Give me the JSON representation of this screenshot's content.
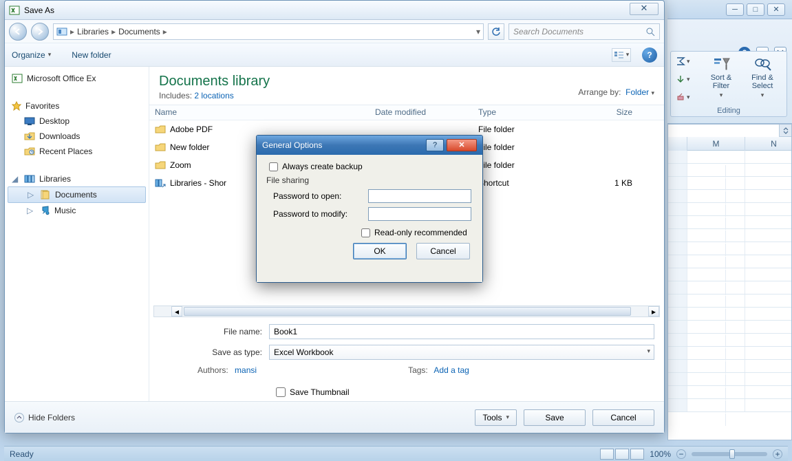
{
  "saveas": {
    "title": "Save As",
    "breadcrumb": [
      "Libraries",
      "Documents"
    ],
    "search_placeholder": "Search Documents",
    "organize": "Organize",
    "new_folder": "New folder",
    "library_title": "Documents library",
    "includes_label": "Includes:",
    "includes_link": "2 locations",
    "arrange_label": "Arrange by:",
    "arrange_value": "Folder",
    "columns": {
      "name": "Name",
      "date": "Date modified",
      "type": "Type",
      "size": "Size"
    },
    "rows": [
      {
        "name": "Adobe PDF",
        "type": "File folder",
        "size": ""
      },
      {
        "name": "New folder",
        "type": "File folder",
        "size": ""
      },
      {
        "name": "Zoom",
        "type": "File folder",
        "size": ""
      },
      {
        "name": "Libraries - Shor",
        "type": "Shortcut",
        "size": "1 KB"
      }
    ],
    "filename_label": "File name:",
    "filename_value": "Book1",
    "savetype_label": "Save as type:",
    "savetype_value": "Excel Workbook",
    "authors_label": "Authors:",
    "authors_value": "mansi",
    "tags_label": "Tags:",
    "tags_value": "Add a tag",
    "save_thumbnail": "Save Thumbnail",
    "hide_folders": "Hide Folders",
    "tools": "Tools",
    "save": "Save",
    "cancel": "Cancel"
  },
  "nav": {
    "office": "Microsoft Office Ex",
    "favorites": "Favorites",
    "desktop": "Desktop",
    "downloads": "Downloads",
    "recent": "Recent Places",
    "libraries": "Libraries",
    "documents": "Documents",
    "music": "Music"
  },
  "modal": {
    "title": "General Options",
    "always_backup": "Always create backup",
    "file_sharing": "File sharing",
    "pw_open": "Password to open:",
    "pw_modify": "Password to modify:",
    "readonly": "Read-only recommended",
    "ok": "OK",
    "cancel": "Cancel"
  },
  "ribbon": {
    "sort_filter": "Sort & Filter",
    "find_select": "Find & Select",
    "editing": "Editing"
  },
  "grid": {
    "colM": "M",
    "colN": "N"
  },
  "status": {
    "ready": "Ready",
    "zoom": "100%"
  }
}
